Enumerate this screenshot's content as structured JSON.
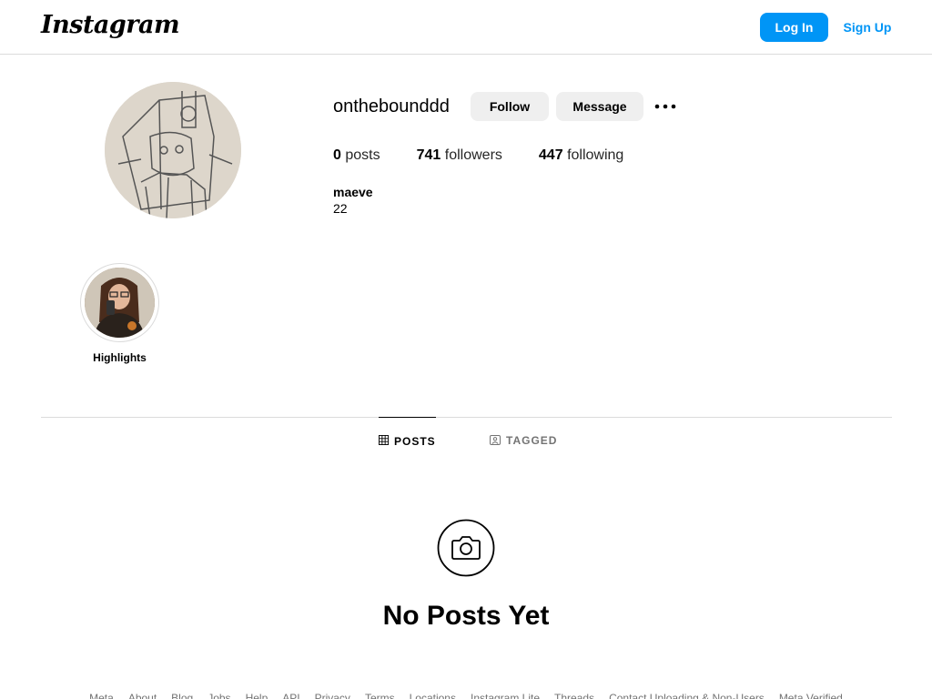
{
  "header": {
    "logo": "Instagram",
    "login_label": "Log In",
    "signup_label": "Sign Up",
    "accent_color": "#0095f6"
  },
  "profile": {
    "username": "onthebounddd",
    "follow_label": "Follow",
    "message_label": "Message",
    "more_icon": "more-horizontal-icon",
    "stats": {
      "posts_count": "0",
      "posts_label": "posts",
      "followers_count": "741",
      "followers_label": "followers",
      "following_count": "447",
      "following_label": "following"
    },
    "full_name": "maeve",
    "bio": "22"
  },
  "highlights": [
    {
      "label": "Highlights"
    }
  ],
  "tabs": [
    {
      "label": "POSTS",
      "icon": "grid-icon",
      "active": true
    },
    {
      "label": "TAGGED",
      "icon": "tagged-icon",
      "active": false
    }
  ],
  "empty_state": {
    "icon": "camera-icon",
    "title": "No Posts Yet"
  },
  "footer": {
    "links": [
      "Meta",
      "About",
      "Blog",
      "Jobs",
      "Help",
      "API",
      "Privacy",
      "Terms",
      "Locations",
      "Instagram Lite",
      "Threads",
      "Contact Uploading & Non-Users",
      "Meta Verified"
    ]
  }
}
